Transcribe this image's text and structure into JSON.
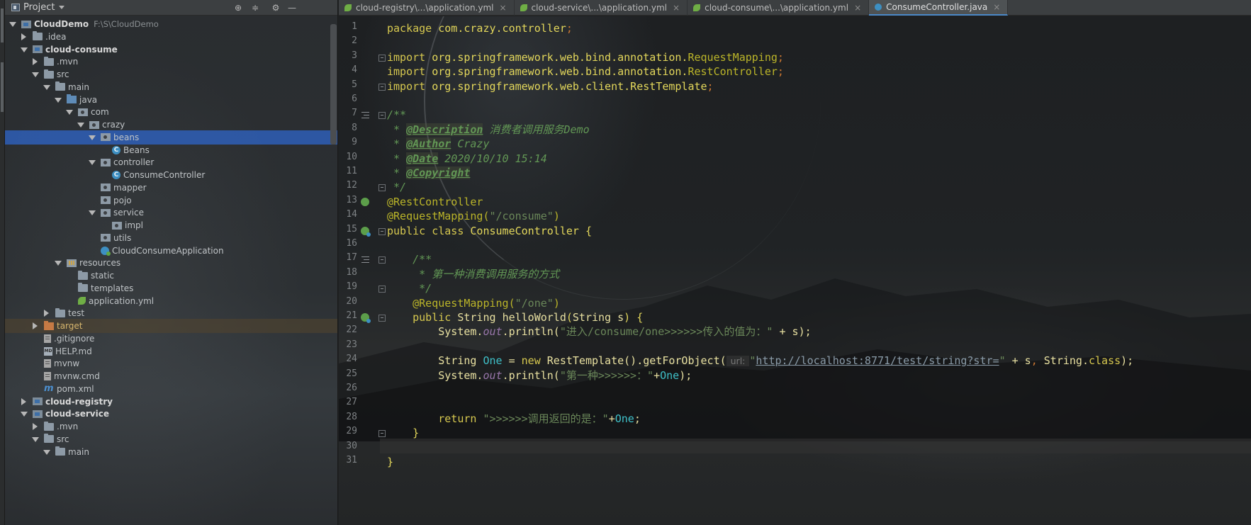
{
  "project_panel": {
    "title": "Project",
    "tree": [
      {
        "label": "CloudDemo",
        "path": "F:\\S\\CloudDemo",
        "depth": 0,
        "arrow": "down",
        "icon": "module",
        "bold": true
      },
      {
        "label": ".idea",
        "depth": 1,
        "arrow": "right",
        "icon": "folder"
      },
      {
        "label": "cloud-consume",
        "depth": 1,
        "arrow": "down",
        "icon": "module",
        "bold": true
      },
      {
        "label": ".mvn",
        "depth": 2,
        "arrow": "right",
        "icon": "folder"
      },
      {
        "label": "src",
        "depth": 2,
        "arrow": "down",
        "icon": "folder"
      },
      {
        "label": "main",
        "depth": 3,
        "arrow": "down",
        "icon": "folder"
      },
      {
        "label": "java",
        "depth": 4,
        "arrow": "down",
        "icon": "src"
      },
      {
        "label": "com",
        "depth": 5,
        "arrow": "down",
        "icon": "pkg"
      },
      {
        "label": "crazy",
        "depth": 6,
        "arrow": "down",
        "icon": "pkg"
      },
      {
        "label": "beans",
        "depth": 7,
        "arrow": "down",
        "icon": "pkg",
        "selected": true
      },
      {
        "label": "Beans",
        "depth": 8,
        "arrow": "none",
        "icon": "cls"
      },
      {
        "label": "controller",
        "depth": 7,
        "arrow": "down",
        "icon": "pkg"
      },
      {
        "label": "ConsumeController",
        "depth": 8,
        "arrow": "none",
        "icon": "cls"
      },
      {
        "label": "mapper",
        "depth": 7,
        "arrow": "none",
        "icon": "pkg"
      },
      {
        "label": "pojo",
        "depth": 7,
        "arrow": "none",
        "icon": "pkg"
      },
      {
        "label": "service",
        "depth": 7,
        "arrow": "down",
        "icon": "pkg"
      },
      {
        "label": "impl",
        "depth": 8,
        "arrow": "none",
        "icon": "pkg"
      },
      {
        "label": "utils",
        "depth": 7,
        "arrow": "none",
        "icon": "pkg"
      },
      {
        "label": "CloudConsumeApplication",
        "depth": 7,
        "arrow": "none",
        "icon": "appcls"
      },
      {
        "label": "resources",
        "depth": 4,
        "arrow": "down",
        "icon": "res"
      },
      {
        "label": "static",
        "depth": 5,
        "arrow": "none",
        "icon": "folder"
      },
      {
        "label": "templates",
        "depth": 5,
        "arrow": "none",
        "icon": "folder"
      },
      {
        "label": "application.yml",
        "depth": 5,
        "arrow": "none",
        "icon": "yml"
      },
      {
        "label": "test",
        "depth": 3,
        "arrow": "right",
        "icon": "folder"
      },
      {
        "label": "target",
        "depth": 2,
        "arrow": "right",
        "icon": "target",
        "excluded": true
      },
      {
        "label": ".gitignore",
        "depth": 2,
        "arrow": "none",
        "icon": "file"
      },
      {
        "label": "HELP.md",
        "depth": 2,
        "arrow": "none",
        "icon": "md"
      },
      {
        "label": "mvnw",
        "depth": 2,
        "arrow": "none",
        "icon": "file"
      },
      {
        "label": "mvnw.cmd",
        "depth": 2,
        "arrow": "none",
        "icon": "file"
      },
      {
        "label": "pom.xml",
        "depth": 2,
        "arrow": "none",
        "icon": "maven"
      },
      {
        "label": "cloud-registry",
        "depth": 1,
        "arrow": "right",
        "icon": "module",
        "bold": true
      },
      {
        "label": "cloud-service",
        "depth": 1,
        "arrow": "down",
        "icon": "module",
        "bold": true
      },
      {
        "label": ".mvn",
        "depth": 2,
        "arrow": "right",
        "icon": "folder"
      },
      {
        "label": "src",
        "depth": 2,
        "arrow": "down",
        "icon": "folder"
      },
      {
        "label": "main",
        "depth": 3,
        "arrow": "down",
        "icon": "folder"
      }
    ]
  },
  "tabs": [
    {
      "label": "cloud-registry\\...\\application.yml",
      "icon": "yml",
      "active": false
    },
    {
      "label": "cloud-service\\...\\application.yml",
      "icon": "yml",
      "active": false
    },
    {
      "label": "cloud-consume\\...\\application.yml",
      "icon": "yml",
      "active": false
    },
    {
      "label": "ConsumeController.java",
      "icon": "cls",
      "active": true
    }
  ],
  "tab_close_glyph": "×",
  "editor": {
    "line_numbers": [
      "1",
      "2",
      "3",
      "4",
      "5",
      "6",
      "7",
      "8",
      "9",
      "10",
      "11",
      "12",
      "13",
      "14",
      "15",
      "16",
      "17",
      "18",
      "19",
      "20",
      "21",
      "22",
      "23",
      "24",
      "25",
      "26",
      "27",
      "28",
      "29",
      "30",
      "31"
    ],
    "lines": [
      [
        {
          "t": "package ",
          "c": "kwy"
        },
        {
          "t": "com.crazy.controller",
          "c": "yel"
        },
        {
          "t": ";",
          "c": "kw"
        }
      ],
      [],
      [
        {
          "t": "import ",
          "c": "kwy"
        },
        {
          "t": "org.springframework.web.bind.annotation.",
          "c": "yel"
        },
        {
          "t": "RequestMapping",
          "c": "ann"
        },
        {
          "t": ";",
          "c": "kw"
        }
      ],
      [
        {
          "t": "import ",
          "c": "kwy"
        },
        {
          "t": "org.springframework.web.bind.annotation.",
          "c": "yel"
        },
        {
          "t": "RestController",
          "c": "ann"
        },
        {
          "t": ";",
          "c": "kw"
        }
      ],
      [
        {
          "t": "import ",
          "c": "kwy"
        },
        {
          "t": "org.springframework.web.client.RestTemplate",
          "c": "yel"
        },
        {
          "t": ";",
          "c": "kw"
        }
      ],
      [],
      [
        {
          "t": "/**",
          "c": "doc"
        }
      ],
      [
        {
          "t": " * ",
          "c": "doc"
        },
        {
          "t": "@Description",
          "c": "tag"
        },
        {
          "t": " 消费者调用服务Demo",
          "c": "doc"
        }
      ],
      [
        {
          "t": " * ",
          "c": "doc"
        },
        {
          "t": "@Author",
          "c": "tag"
        },
        {
          "t": " Crazy",
          "c": "doc"
        }
      ],
      [
        {
          "t": " * ",
          "c": "doc"
        },
        {
          "t": "@Date",
          "c": "tag"
        },
        {
          "t": " 2020/10/10 15:14",
          "c": "doc"
        }
      ],
      [
        {
          "t": " * ",
          "c": "doc"
        },
        {
          "t": "@Copyright",
          "c": "tag"
        }
      ],
      [
        {
          "t": " */",
          "c": "doc"
        }
      ],
      [
        {
          "t": "@RestController",
          "c": "ann"
        }
      ],
      [
        {
          "t": "@RequestMapping(",
          "c": "ann"
        },
        {
          "t": "\"/consume\"",
          "c": "str"
        },
        {
          "t": ")",
          "c": "ann"
        }
      ],
      [
        {
          "t": "public class ",
          "c": "kwy"
        },
        {
          "t": "ConsumeController ",
          "c": "cls-name"
        },
        {
          "t": "{",
          "c": "yel"
        }
      ],
      [],
      [
        {
          "t": "    /**",
          "c": "doc"
        }
      ],
      [
        {
          "t": "     * 第一种消费调用服务的方式",
          "c": "doc"
        }
      ],
      [
        {
          "t": "     */",
          "c": "doc"
        }
      ],
      [
        {
          "t": "    @RequestMapping(",
          "c": "ann"
        },
        {
          "t": "\"/one\"",
          "c": "str"
        },
        {
          "t": ")",
          "c": "ann"
        }
      ],
      [
        {
          "t": "    public ",
          "c": "kwy"
        },
        {
          "t": "String ",
          "c": "fn"
        },
        {
          "t": "helloWorld",
          "c": "fn"
        },
        {
          "t": "(",
          "c": "yel"
        },
        {
          "t": "String ",
          "c": "fn"
        },
        {
          "t": "s",
          "c": "fn"
        },
        {
          "t": ") {",
          "c": "yel"
        }
      ],
      [
        {
          "t": "        System.",
          "c": "fn"
        },
        {
          "t": "out",
          "c": "fld"
        },
        {
          "t": ".println(",
          "c": "fn"
        },
        {
          "t": "\"进入/consume/one>>>>>>传入的值为：\"",
          "c": "str"
        },
        {
          "t": " + s);",
          "c": "fn"
        }
      ],
      [],
      [
        {
          "t": "        String ",
          "c": "fn"
        },
        {
          "t": "One",
          "c": "teal"
        },
        {
          "t": " = ",
          "c": "fn"
        },
        {
          "t": "new ",
          "c": "kwy"
        },
        {
          "t": "RestTemplate().getForObject(",
          "c": "fn"
        },
        {
          "t": " url: ",
          "c": "hint"
        },
        {
          "t": "\"",
          "c": "str"
        },
        {
          "t": "http://localhost:8771/test/string?str=",
          "c": "url"
        },
        {
          "t": "\"",
          "c": "str"
        },
        {
          "t": " + s",
          "c": "fn"
        },
        {
          "t": ", ",
          "c": "kw"
        },
        {
          "t": "String",
          "c": "fn"
        },
        {
          "t": ".",
          "c": "fn"
        },
        {
          "t": "class",
          "c": "kwy"
        },
        {
          "t": ");",
          "c": "fn"
        }
      ],
      [
        {
          "t": "        System.",
          "c": "fn"
        },
        {
          "t": "out",
          "c": "fld"
        },
        {
          "t": ".println(",
          "c": "fn"
        },
        {
          "t": "\"第一种>>>>>>：\"",
          "c": "str"
        },
        {
          "t": "+",
          "c": "fn"
        },
        {
          "t": "One",
          "c": "teal"
        },
        {
          "t": ");",
          "c": "fn"
        }
      ],
      [],
      [],
      [
        {
          "t": "        return ",
          "c": "kwy"
        },
        {
          "t": "\">>>>>>调用返回的是：\"",
          "c": "str"
        },
        {
          "t": "+",
          "c": "fn"
        },
        {
          "t": "One",
          "c": "teal"
        },
        {
          "t": ";",
          "c": "fn"
        }
      ],
      [
        {
          "t": "    }",
          "c": "yel"
        }
      ],
      [],
      [
        {
          "t": "}",
          "c": "yel"
        }
      ]
    ]
  },
  "colors": {
    "selection": "#2f65ca",
    "active_tab_underline": "#4a88c7",
    "keyword": "#d6c84f",
    "string": "#6a8759",
    "doc_comment": "#629755",
    "annotation": "#bbb529"
  }
}
